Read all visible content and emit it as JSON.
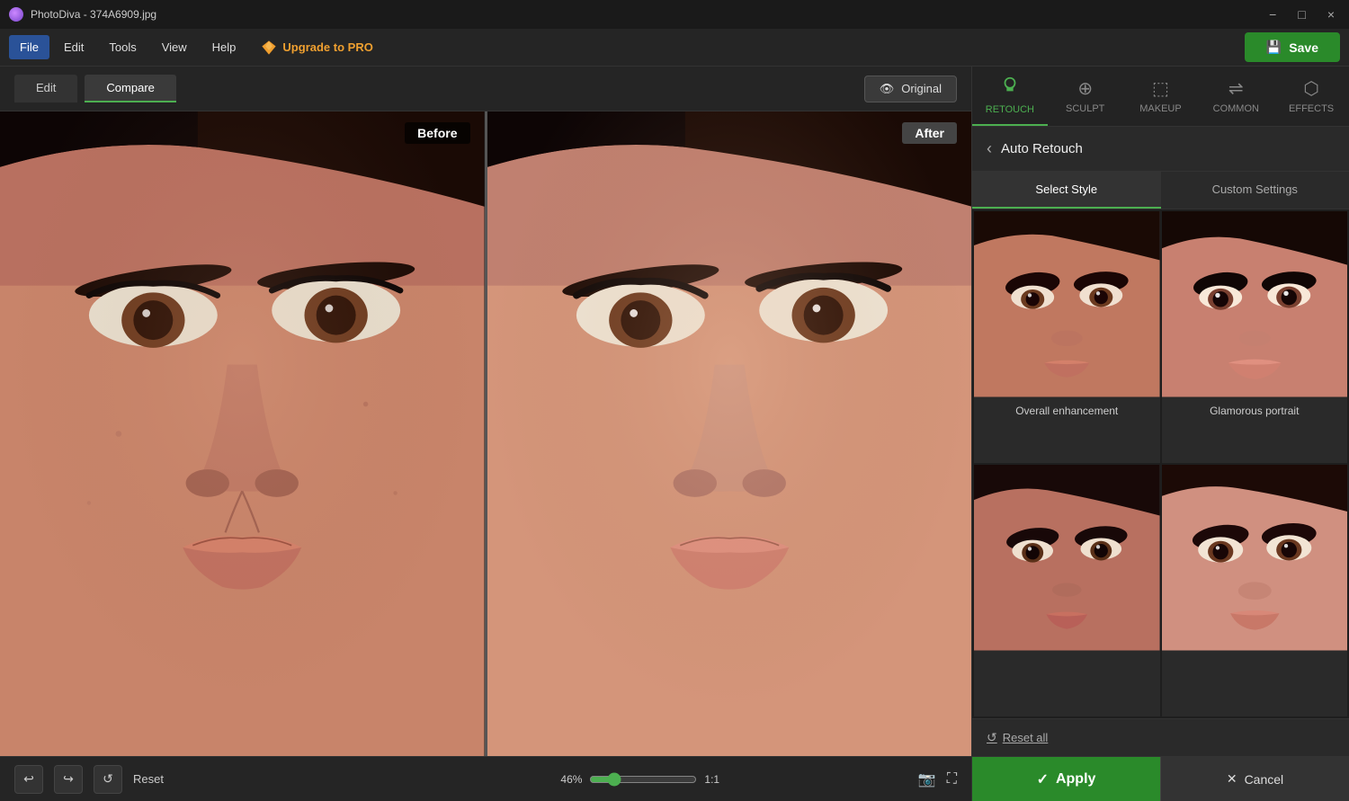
{
  "app": {
    "title": "PhotoDiva - 374A6909.jpg",
    "icon": "photodiva-icon"
  },
  "titlebar": {
    "minimize_label": "−",
    "maximize_label": "□",
    "close_label": "×"
  },
  "menubar": {
    "items": [
      "File",
      "Edit",
      "Tools",
      "View",
      "Help"
    ],
    "upgrade_label": "Upgrade to PRO",
    "save_label": "Save"
  },
  "canvas_toolbar": {
    "edit_tab": "Edit",
    "compare_tab": "Compare",
    "original_label": "Original"
  },
  "canvas": {
    "before_label": "Before",
    "after_label": "After"
  },
  "status_bar": {
    "zoom_percent": "46%",
    "ratio_label": "1:1",
    "reset_label": "Reset"
  },
  "panel": {
    "tabs": [
      {
        "id": "retouch",
        "label": "RETOUCH",
        "icon": "✦"
      },
      {
        "id": "sculpt",
        "label": "SCULPT",
        "icon": "⊕"
      },
      {
        "id": "makeup",
        "label": "MAKEUP",
        "icon": "⬚"
      },
      {
        "id": "common",
        "label": "COMMON",
        "icon": "⇌"
      },
      {
        "id": "effects",
        "label": "EFFECTS",
        "icon": "⬡"
      }
    ],
    "active_tab": "retouch",
    "back_label": "‹",
    "subtitle": "Auto Retouch",
    "select_style_tab": "Select Style",
    "custom_settings_tab": "Custom Settings",
    "style_items": [
      {
        "id": "overall",
        "label": "Overall enhancement"
      },
      {
        "id": "glamorous",
        "label": "Glamorous portrait"
      },
      {
        "id": "style3",
        "label": ""
      },
      {
        "id": "style4",
        "label": ""
      }
    ],
    "reset_all_label": "Reset all",
    "apply_label": "Apply",
    "cancel_label": "Cancel"
  }
}
